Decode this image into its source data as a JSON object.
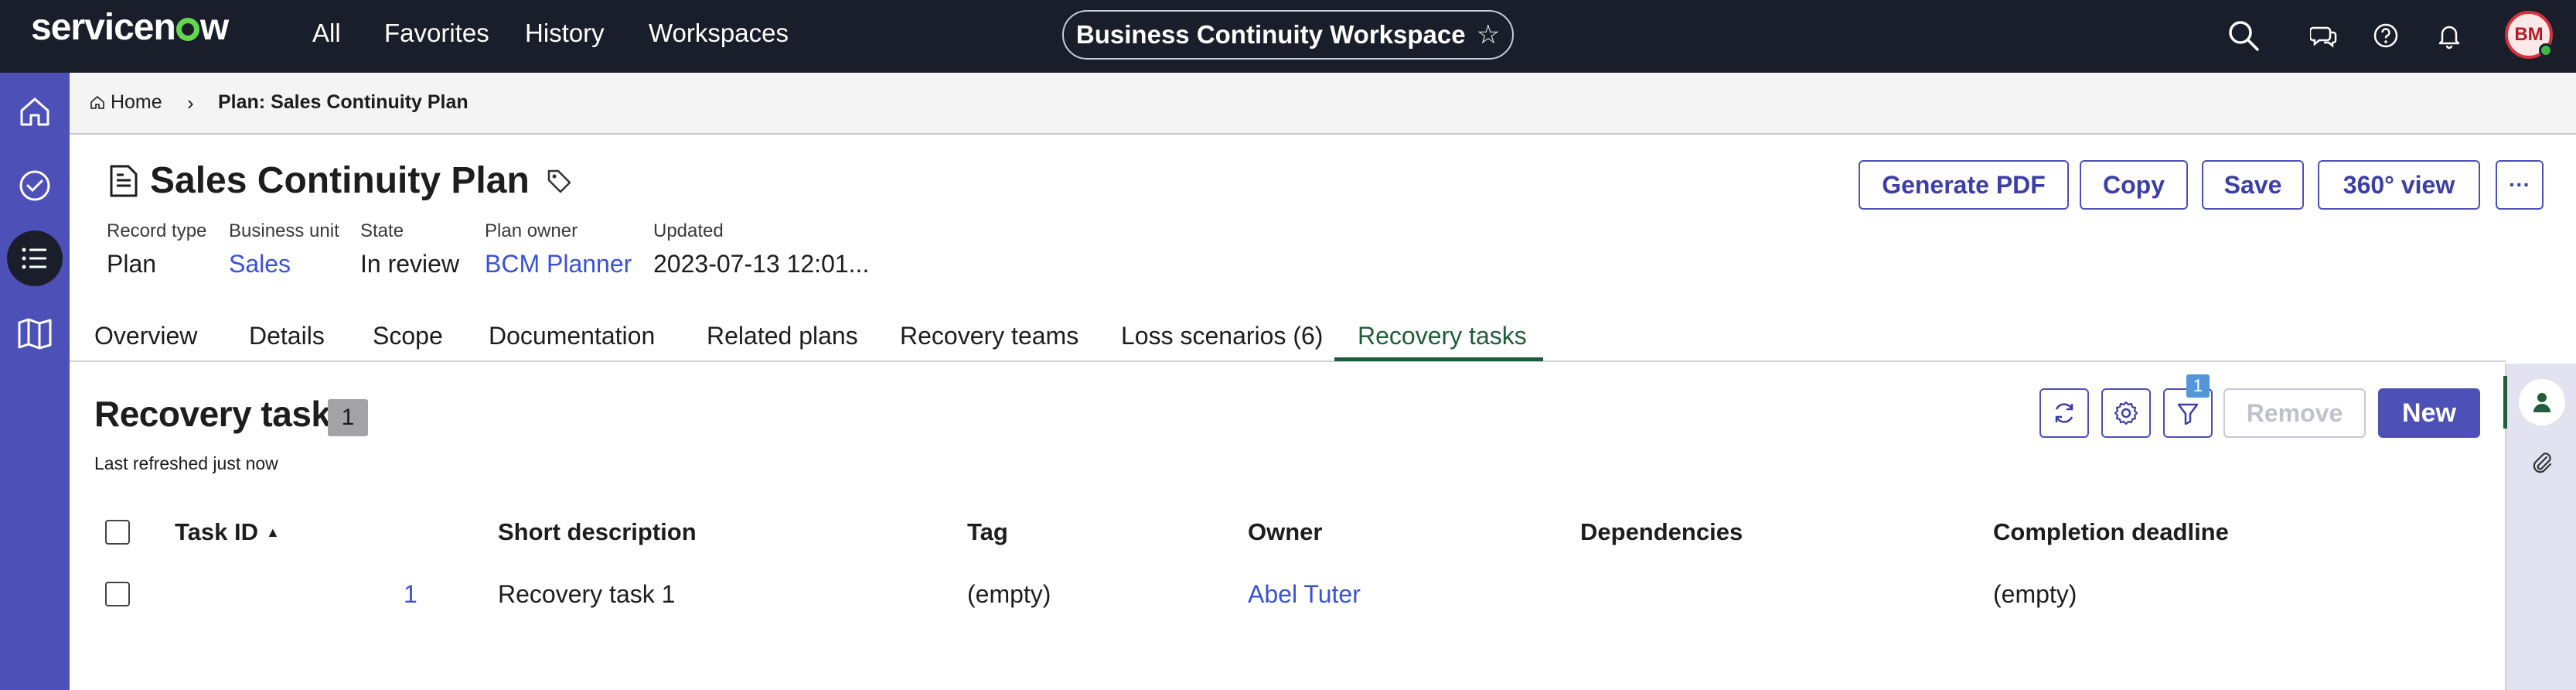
{
  "topnav": {
    "logo": "servicenow",
    "items": [
      "All",
      "Favorites",
      "History",
      "Workspaces"
    ],
    "workspace_title": "Business Continuity Workspace",
    "avatar_initials": "BM"
  },
  "breadcrumb": {
    "home": "Home",
    "current": "Plan: Sales Continuity Plan"
  },
  "header": {
    "title": "Sales Continuity Plan",
    "buttons": {
      "generate_pdf": "Generate PDF",
      "copy": "Copy",
      "save": "Save",
      "view360": "360° view",
      "more": "···"
    },
    "meta": [
      {
        "label": "Record type",
        "value": "Plan"
      },
      {
        "label": "Business unit",
        "value": "Sales"
      },
      {
        "label": "State",
        "value": "In review"
      },
      {
        "label": "Plan owner",
        "value": "BCM Planner"
      },
      {
        "label": "Updated",
        "value": "2023-07-13 12:01..."
      }
    ]
  },
  "tabs": [
    "Overview",
    "Details",
    "Scope",
    "Documentation",
    "Related plans",
    "Recovery teams",
    "Loss scenarios (6)",
    "Recovery tasks"
  ],
  "list": {
    "title": "Recovery task",
    "count": "1",
    "refreshed": "Last refreshed just now",
    "filter_count": "1",
    "remove_label": "Remove",
    "new_label": "New",
    "columns": [
      "Task ID",
      "Short description",
      "Tag",
      "Owner",
      "Dependencies",
      "Completion deadline"
    ],
    "rows": [
      {
        "task_id": "1",
        "short_description": "Recovery task 1",
        "tag": "(empty)",
        "owner": "Abel Tuter",
        "dependencies": "",
        "completion_deadline": "(empty)"
      }
    ]
  },
  "colors": {
    "topbar": "#1a1e2b",
    "rail": "#4d50b7",
    "accent": "#4d50b7",
    "link": "#3a52d6",
    "active_tab": "#1f5d3b"
  }
}
